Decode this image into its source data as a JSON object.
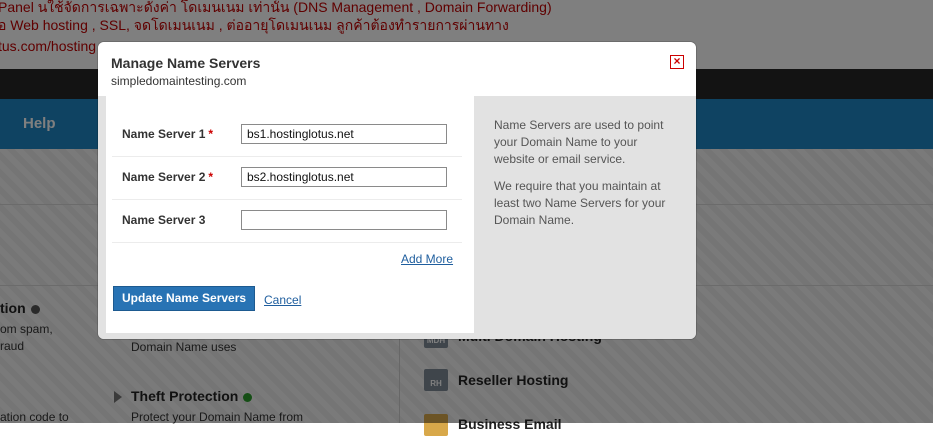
{
  "background": {
    "top_lines": [
      "Panel นใช้จัดการเฉพาะดังค่า โดเมนเนม เท่านั้น (DNS Management , Domain Forwarding)",
      "อ Web hosting , SSL, จดโดเมนเนม , ต่ออายุโดเมนเนม ลูกค้าต้องทำรายการผ่านทาง",
      "tus.com/hosting"
    ],
    "nav_help": "Help",
    "left_items": [
      {
        "title": "tion",
        "lines": [
          "om spam,",
          "raud"
        ]
      },
      {
        "title": "",
        "lines": [
          "ation code to"
        ]
      }
    ],
    "middle_text": "Domain Name uses",
    "theft_title": "Theft Protection",
    "theft_desc": "Protect your Domain Name from",
    "right_items": [
      {
        "label": "Multi Domain Hosting",
        "icon": "MDH"
      },
      {
        "label": "Reseller Hosting",
        "icon": "RH"
      },
      {
        "label": "Business Email",
        "icon": ""
      }
    ]
  },
  "modal": {
    "title": "Manage Name Servers",
    "subtitle": "simpledomaintesting.com",
    "fields": [
      {
        "label": "Name Server 1",
        "required": "*",
        "value": "bs1.hostinglotus.net"
      },
      {
        "label": "Name Server 2",
        "required": "*",
        "value": "bs2.hostinglotus.net"
      },
      {
        "label": "Name Server 3",
        "required": "",
        "value": ""
      }
    ],
    "add_more": "Add More",
    "update_button": "Update Name Servers",
    "cancel": "Cancel",
    "info": [
      "Name Servers are used to point your Domain Name to your website or email service.",
      "We require that you maintain at least two Name Servers for your Domain Name."
    ]
  }
}
